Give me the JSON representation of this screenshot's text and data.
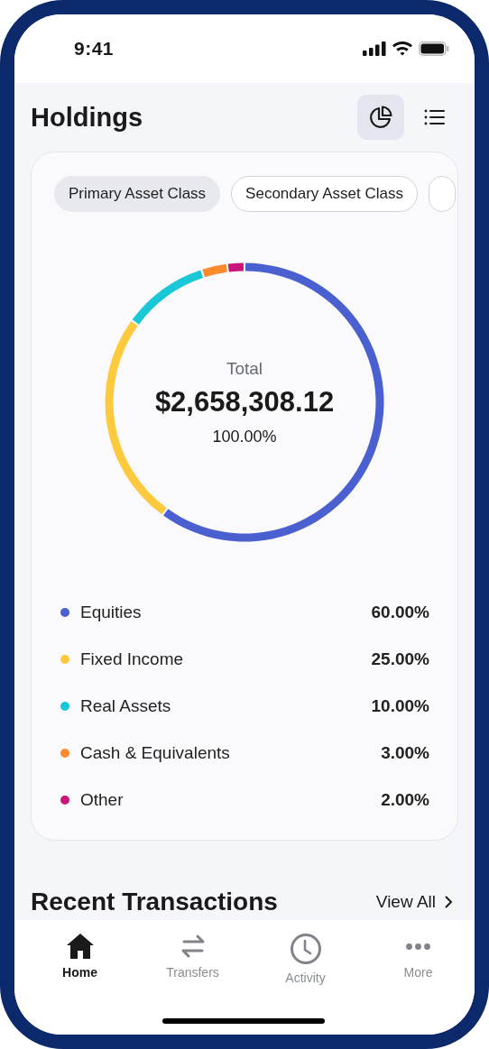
{
  "status_bar": {
    "time": "9:41"
  },
  "header": {
    "title": "Holdings",
    "views": [
      {
        "kind": "chart",
        "selected": true
      },
      {
        "kind": "list",
        "selected": false
      }
    ]
  },
  "filters": [
    {
      "label": "Primary Asset Class",
      "selected": true
    },
    {
      "label": "Secondary Asset Class",
      "selected": false
    }
  ],
  "donut": {
    "label": "Total",
    "amount": "$2,658,308.12",
    "percent": "100.00%",
    "chart_data": {
      "type": "donut",
      "categories": [
        "Equities",
        "Fixed Income",
        "Real Assets",
        "Cash & Equivalents",
        "Other"
      ],
      "values": [
        60,
        25,
        10,
        3,
        2
      ]
    }
  },
  "legend": [
    {
      "value": "60.00%",
      "color": "#4a5fd0"
    },
    {
      "value": "25.00%",
      "color": "#fdc93d"
    },
    {
      "value": "10.00%",
      "color": "#19c7d6"
    },
    {
      "value": "3.00%",
      "color": "#fb8b2c"
    },
    {
      "value": "2.00%",
      "color": "#c8157a"
    }
  ],
  "recent": {
    "title": "Recent Transactions",
    "link": "View All"
  },
  "tab_bar": [
    {
      "label": "Home",
      "kind": "home",
      "selected": true
    },
    {
      "label": "Transfers",
      "kind": "transfers",
      "selected": false
    },
    {
      "label": "Activity",
      "kind": "activity",
      "selected": false
    },
    {
      "label": "More",
      "kind": "more",
      "selected": false
    }
  ]
}
